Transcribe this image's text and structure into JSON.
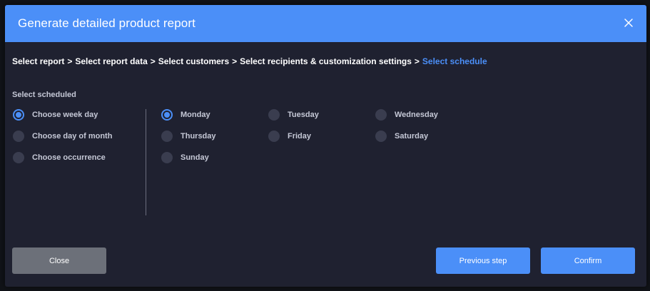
{
  "dialog": {
    "title": "Generate detailed product report",
    "close_icon": "close-icon"
  },
  "breadcrumb": {
    "items": [
      "Select report",
      "Select report data",
      "Select customers",
      "Select recipients & customization settings",
      "Select schedule"
    ],
    "separator": ">",
    "active_index": 4
  },
  "schedule": {
    "section_label": "Select scheduled",
    "modes": [
      {
        "label": "Choose week day",
        "checked": true
      },
      {
        "label": "Choose day of month",
        "checked": false
      },
      {
        "label": "Choose occurrence",
        "checked": false
      }
    ],
    "weekdays": [
      {
        "label": "Monday",
        "checked": true
      },
      {
        "label": "Tuesday",
        "checked": false
      },
      {
        "label": "Wednesday",
        "checked": false
      },
      {
        "label": "Thursday",
        "checked": false
      },
      {
        "label": "Friday",
        "checked": false
      },
      {
        "label": "Saturday",
        "checked": false
      },
      {
        "label": "Sunday",
        "checked": false
      }
    ]
  },
  "footer": {
    "close_label": "Close",
    "previous_label": "Previous step",
    "confirm_label": "Confirm"
  },
  "colors": {
    "accent": "#4b8ff8",
    "background": "#1f2130",
    "muted_button": "#6c7079"
  }
}
